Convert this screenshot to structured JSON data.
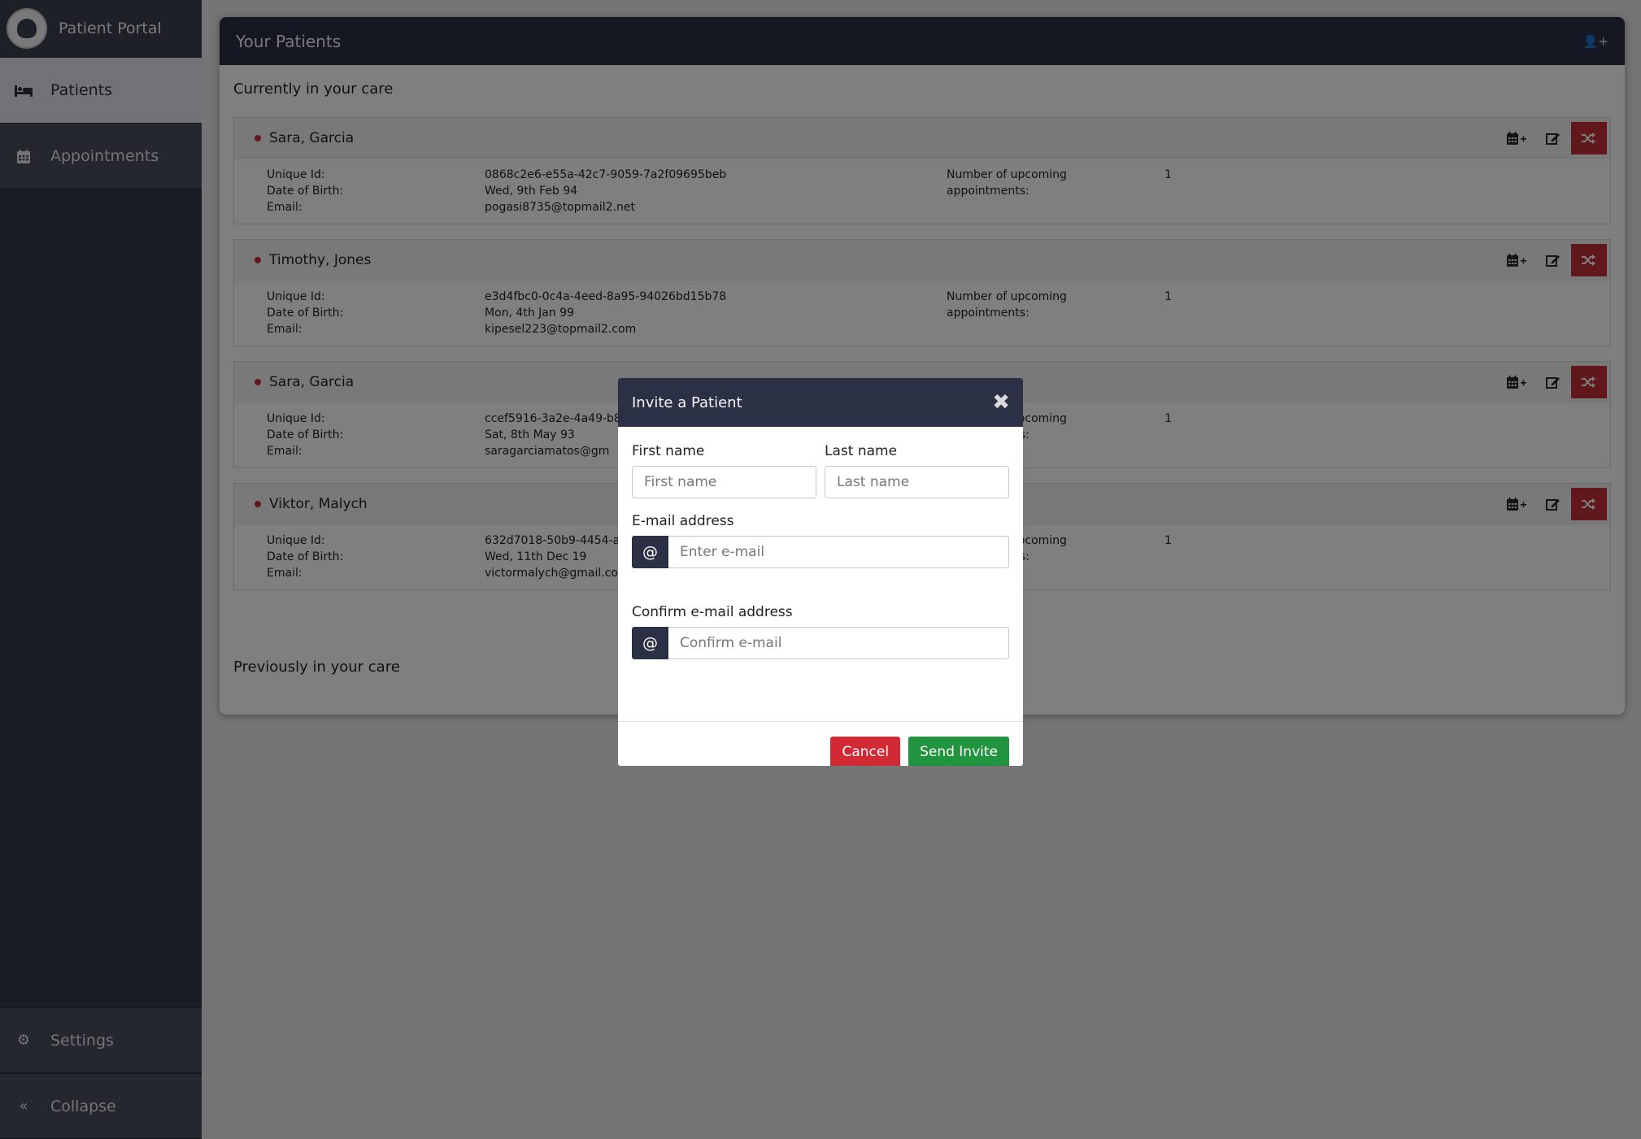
{
  "sidebar": {
    "brand": "Patient Portal",
    "items": [
      {
        "label": "Patients",
        "icon": "bed-icon",
        "active": true
      },
      {
        "label": "Appointments",
        "icon": "calendar-icon",
        "active": false
      }
    ],
    "bottom": [
      {
        "label": "Settings",
        "icon": "gear-icon"
      },
      {
        "label": "Collapse",
        "icon": "double-chevron-left-icon"
      }
    ]
  },
  "panel": {
    "title": "Your Patients",
    "current_title": "Currently in your care",
    "previous_title": "Previously in your care",
    "field_labels": {
      "unique_id": "Unique Id:",
      "dob": "Date of Birth:",
      "email": "Email:",
      "upcoming_line1": "Number of upcoming",
      "upcoming_line2": "appointments:"
    },
    "patients": [
      {
        "name": "Sara, Garcia",
        "id": "0868c2e6-e55a-42c7-9059-7a2f09695beb",
        "dob": "Wed, 9th Feb 94",
        "email": "pogasi8735@topmail2.net",
        "upcoming": "1"
      },
      {
        "name": "Timothy, Jones",
        "id": "e3d4fbc0-0c4a-4eed-8a95-94026bd15b78",
        "dob": "Mon, 4th Jan 99",
        "email": "kipesel223@topmail2.com",
        "upcoming": "1"
      },
      {
        "name": "Sara, Garcia",
        "id": "ccef5916-3a2e-4a49-b8",
        "dob": "Sat, 8th May 93",
        "email": "saragarciamatos@gm",
        "upcoming": "1"
      },
      {
        "name": "Viktor, Malych",
        "id": "632d7018-50b9-4454-ac",
        "dob": "Wed, 11th Dec 19",
        "email": "victormalych@gmail.co",
        "upcoming": "1"
      }
    ]
  },
  "modal": {
    "title": "Invite a Patient",
    "close": "✖",
    "first_name_label": "First name",
    "first_name_placeholder": "First name",
    "last_name_label": "Last name",
    "last_name_placeholder": "Last name",
    "email_label": "E-mail address",
    "email_placeholder": "Enter e-mail",
    "confirm_label": "Confirm e-mail address",
    "confirm_placeholder": "Confirm e-mail",
    "at_symbol": "@",
    "cancel": "Cancel",
    "send": "Send Invite"
  },
  "colors": {
    "header": "#2b3044",
    "sidebar": "#343846",
    "danger": "#d12a35",
    "success": "#21943f",
    "status_dot": "#c62f3a"
  }
}
